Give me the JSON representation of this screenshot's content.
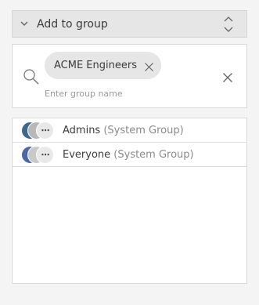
{
  "header": {
    "title": "Add to group"
  },
  "search": {
    "selected_chip": "ACME Engineers",
    "placeholder": "Enter group name"
  },
  "groups": [
    {
      "name": "Admins",
      "type": "(System Group)",
      "more": "⋯",
      "colors": [
        "#3d6a8c",
        "#b8b8b8"
      ]
    },
    {
      "name": "Everyone",
      "type": "(System Group)",
      "more": "⋯",
      "colors": [
        "#4a67a8",
        "#c9c9c9"
      ]
    }
  ],
  "icons": {
    "collapse": "chevron-down-icon",
    "sort": "sort-updown-icon",
    "search": "search-icon",
    "chip_remove": "close-icon",
    "clear": "close-icon",
    "more": "more-icon"
  }
}
